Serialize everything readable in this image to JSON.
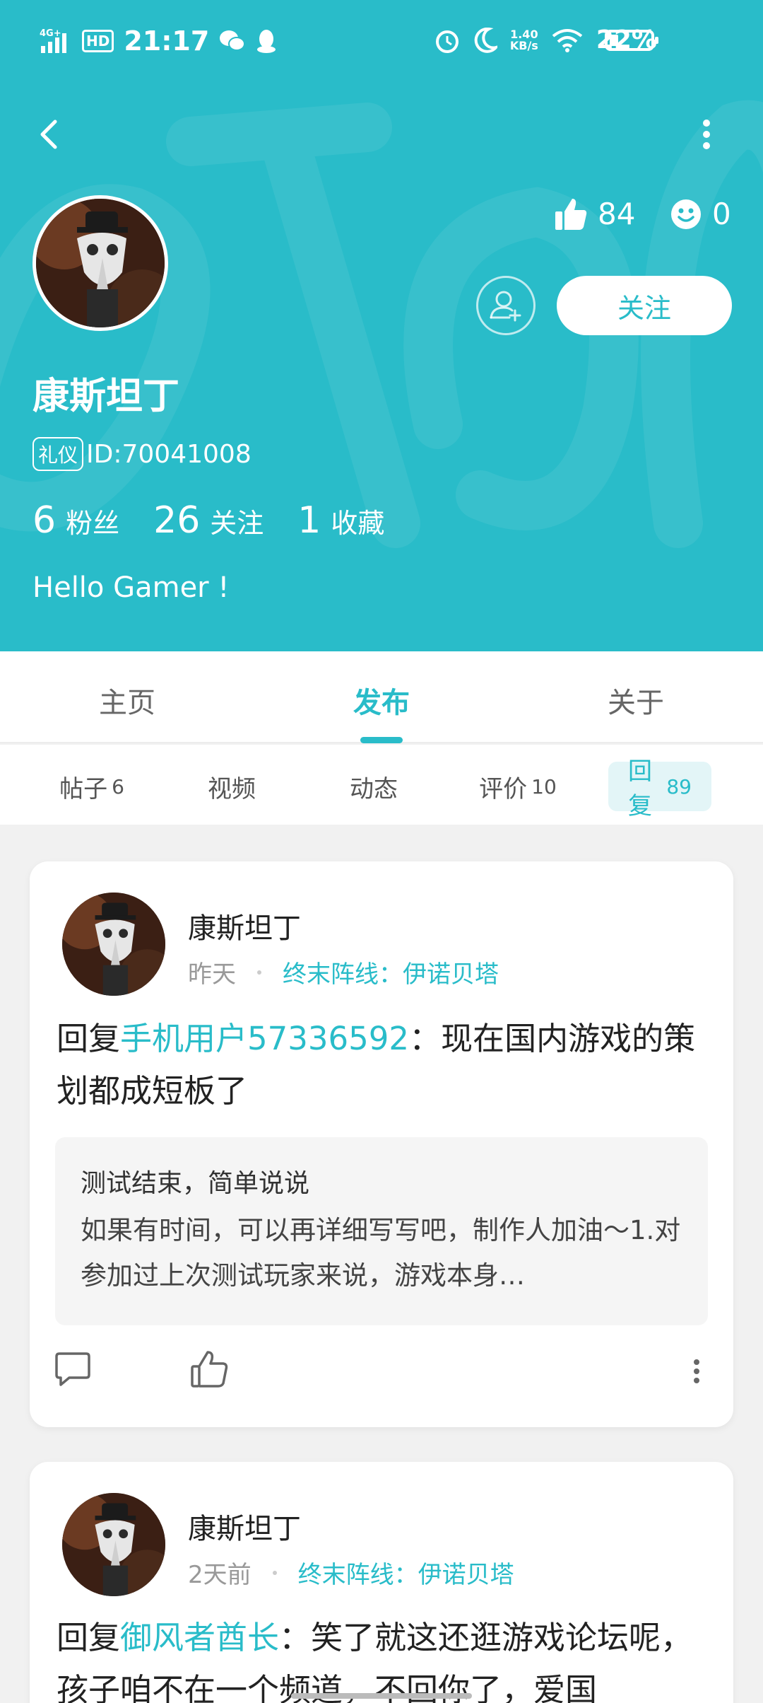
{
  "status_bar": {
    "network": "4G+",
    "hd": "HD",
    "time": "21:17",
    "speed_value": "1.40",
    "speed_unit": "KB/s",
    "battery": "22%"
  },
  "profile": {
    "like_count": "84",
    "emoji_count": "0",
    "follow_label": "关注",
    "name": "康斯坦丁",
    "badge": "礼仪",
    "id_text": "ID:70041008",
    "fans_count": "6",
    "fans_label": "粉丝",
    "following_count": "26",
    "following_label": "关注",
    "favorites_count": "1",
    "favorites_label": "收藏",
    "bio": "Hello Gamer !"
  },
  "tabs": [
    {
      "label": "主页"
    },
    {
      "label": "发布"
    },
    {
      "label": "关于"
    }
  ],
  "subtabs": [
    {
      "label": "帖子",
      "count": "6"
    },
    {
      "label": "视频",
      "count": ""
    },
    {
      "label": "动态",
      "count": ""
    },
    {
      "label": "评价",
      "count": "10"
    },
    {
      "label": "回复",
      "count": "89"
    }
  ],
  "posts": [
    {
      "author": "康斯坦丁",
      "time": "昨天",
      "game": "终末阵线：伊诺贝塔",
      "reply_prefix": "回复",
      "mention": "手机用户57336592",
      "text": "：现在国内游戏的策划都成短板了",
      "quote_title": "测试结束，简单说说",
      "quote_body": "如果有时间，可以再详细写写吧，制作人加油～1.对参加过上次测试玩家来说，游戏本身…"
    },
    {
      "author": "康斯坦丁",
      "time": "2天前",
      "game": "终末阵线：伊诺贝塔",
      "reply_prefix": "回复",
      "mention": "御风者酋长",
      "text": "：笑了就这还逛游戏论坛呢，孩子咱不在一个频道，不回你了，爱国"
    }
  ],
  "colors": {
    "accent": "#29bcc9",
    "header_bg": "#29bcc9",
    "page_bg": "#f1f1f1"
  },
  "icons": {
    "back": "chevron-left-icon",
    "more": "more-vertical-icon",
    "like": "thumbs-up-icon",
    "emoji": "smile-icon",
    "add_friend": "add-friend-icon",
    "comment": "comment-icon",
    "post_like": "thumbs-up-outline-icon",
    "post_more": "more-vertical-icon"
  }
}
